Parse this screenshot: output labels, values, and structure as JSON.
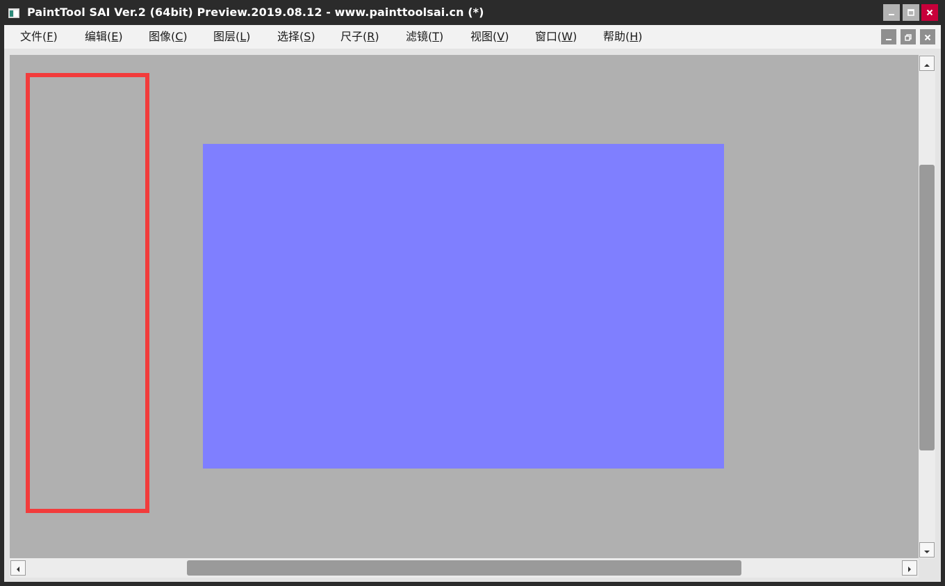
{
  "window": {
    "title": "PaintTool SAI Ver.2 (64bit) Preview.2019.08.12 - www.painttoolsai.cn (*)",
    "icon": "app-icon",
    "buttons": {
      "minimize": "minimize-icon",
      "maximize": "maximize-icon",
      "close": "close-icon"
    },
    "close_color": "#c8003a"
  },
  "menubar": {
    "items": [
      {
        "label": "文件(",
        "mnemonic": "F",
        "tail": ")"
      },
      {
        "label": "编辑(",
        "mnemonic": "E",
        "tail": ")"
      },
      {
        "label": "图像(",
        "mnemonic": "C",
        "tail": ")"
      },
      {
        "label": "图层(",
        "mnemonic": "L",
        "tail": ")"
      },
      {
        "label": "选择(",
        "mnemonic": "S",
        "tail": ")"
      },
      {
        "label": "尺子(",
        "mnemonic": "R",
        "tail": ")"
      },
      {
        "label": "滤镜(",
        "mnemonic": "T",
        "tail": ")"
      },
      {
        "label": "视图(",
        "mnemonic": "V",
        "tail": ")"
      },
      {
        "label": "窗口(",
        "mnemonic": "W",
        "tail": ")"
      },
      {
        "label": "帮助(",
        "mnemonic": "H",
        "tail": ")"
      }
    ],
    "mdi_buttons": {
      "minimize": "minimize-icon",
      "restore": "restore-icon",
      "close": "close-icon"
    }
  },
  "canvas": {
    "background_color": "#b0b0b0",
    "document_color": "#7f7fff",
    "highlight_color": "#f23c3c"
  },
  "scrollbars": {
    "vertical": {
      "up": "arrow-up-icon",
      "down": "arrow-down-icon"
    },
    "horizontal": {
      "left": "arrow-left-icon",
      "right": "arrow-right-icon"
    }
  }
}
